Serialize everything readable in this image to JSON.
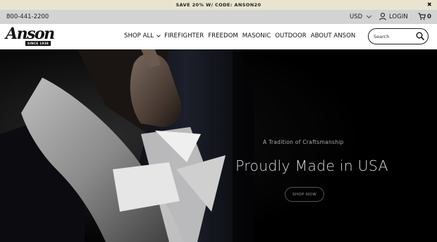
{
  "promo": {
    "text": "SAVE 20% W/ CODE: ANSON20",
    "close": "✖"
  },
  "utility": {
    "phone": "800-441-2200",
    "currency": "USD",
    "login": "LOGIN",
    "cart_count": "0"
  },
  "header": {
    "logo": {
      "wordmark": "Anson",
      "since": "SINCE 1938"
    },
    "nav": [
      {
        "label": "SHOP ALL",
        "has_dropdown": true
      },
      {
        "label": "FIREFIGHTER"
      },
      {
        "label": "FREEDOM"
      },
      {
        "label": "MASONIC"
      },
      {
        "label": "OUTDOOR"
      },
      {
        "label": "ABOUT ANSON"
      }
    ],
    "search": {
      "placeholder": "Search"
    }
  },
  "hero": {
    "kicker": "A Tradition of Craftsmanship",
    "headline": "Proudly Made in USA",
    "cta": "SHOP NOW"
  },
  "colors": {
    "promo_bg": "#e8e4d0",
    "utility_bg": "#d3d3d3",
    "header_bg": "#ffffff",
    "hero_bg": "#000000"
  }
}
